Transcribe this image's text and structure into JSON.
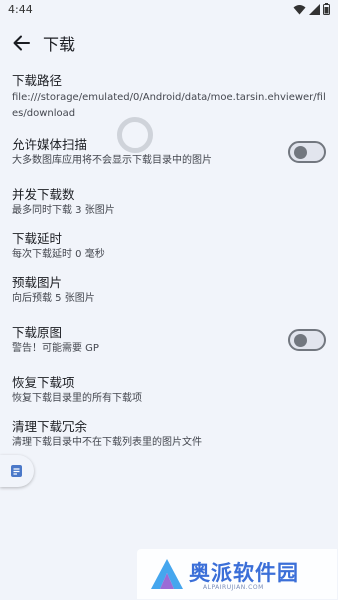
{
  "status_bar": {
    "time": "4:44"
  },
  "app_bar": {
    "title": "下载"
  },
  "settings": {
    "download_path": {
      "title": "下载路径",
      "value": "file:///storage/emulated/0/Android/data/moe.tarsin.ehviewer/files/download"
    },
    "media_scan": {
      "title": "允许媒体扫描",
      "summary": "大多数图库应用将不会显示下载目录中的图片",
      "enabled": false
    },
    "concurrent": {
      "title": "并发下载数",
      "summary": "最多同时下载 3 张图片"
    },
    "delay": {
      "title": "下载延时",
      "summary": "每次下载延时 0 毫秒"
    },
    "preload": {
      "title": "预载图片",
      "summary": "向后预载 5 张图片"
    },
    "original": {
      "title": "下载原图",
      "summary": "警告！可能需要 GP",
      "enabled": false
    },
    "restore": {
      "title": "恢复下载项",
      "summary": "恢复下载目录里的所有下载项"
    },
    "clean": {
      "title": "清理下载冗余",
      "summary": "清理下载目录中不在下载列表里的图片文件"
    }
  },
  "watermark": {
    "brand": "奥派软件园",
    "url": "ALPAIRUJIAN.COM"
  },
  "icons": [
    "wifi-icon",
    "signal-icon",
    "battery-icon",
    "back-arrow-icon",
    "notes-icon"
  ]
}
